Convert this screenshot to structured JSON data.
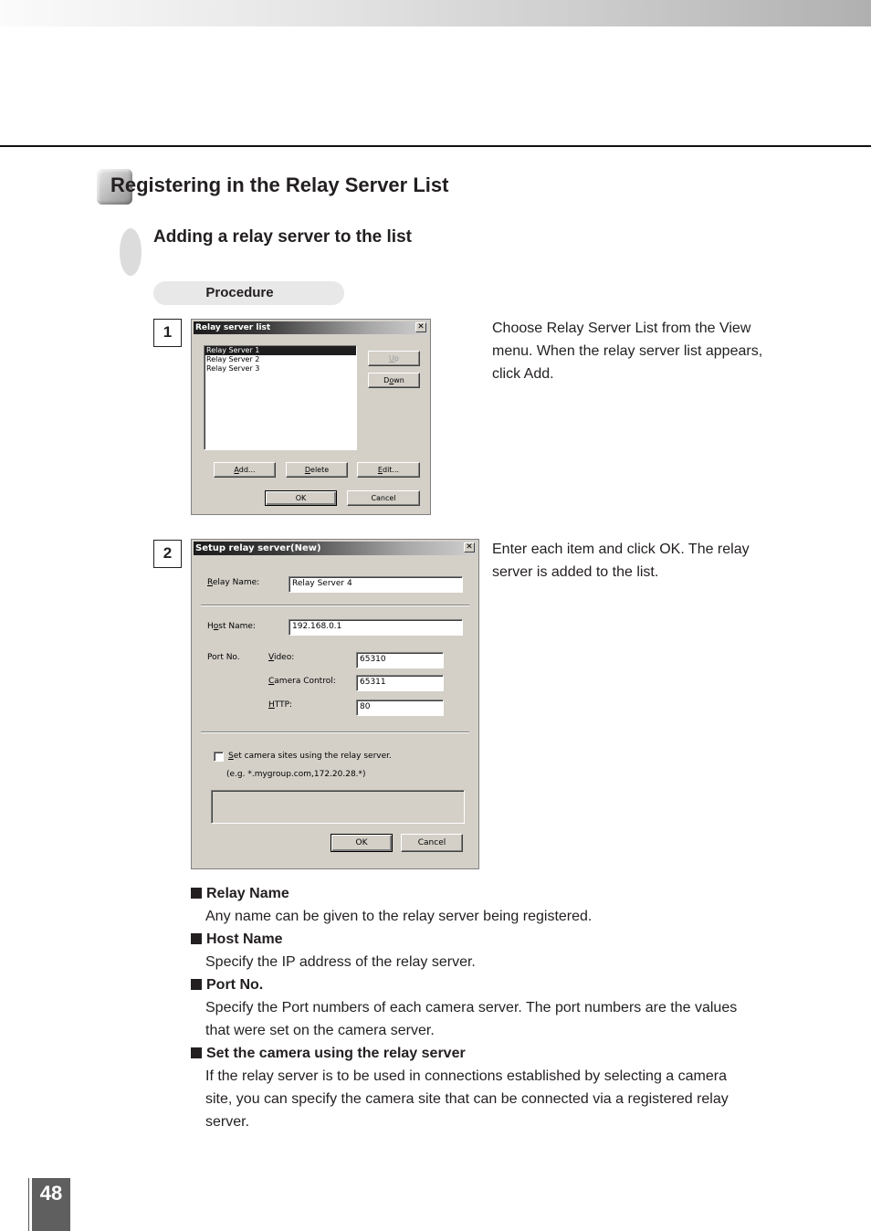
{
  "section_title": "Registering in the Relay Server List",
  "subsection_title": "Adding a relay server to the list",
  "procedure_label": "Procedure",
  "steps": [
    {
      "number": "1",
      "text": "Choose Relay Server List from the View menu. When the relay server list appears, click Add.",
      "dialog": {
        "title": "Relay server list",
        "close_glyph": "✕",
        "list_items": [
          "Relay Server 1",
          "Relay Server 2",
          "Relay Server 3"
        ],
        "selected_index": 0,
        "buttons": {
          "up": {
            "pre": "",
            "u": "U",
            "post": "p"
          },
          "down": {
            "pre": "D",
            "u": "o",
            "post": "wn"
          },
          "add": {
            "pre": "",
            "u": "A",
            "post": "dd..."
          },
          "delete": {
            "pre": "",
            "u": "D",
            "post": "elete"
          },
          "edit": {
            "pre": "",
            "u": "E",
            "post": "dit..."
          },
          "ok": "OK",
          "cancel": "Cancel"
        }
      }
    },
    {
      "number": "2",
      "text": "Enter each item and click OK. The relay server is added to the list.",
      "dialog": {
        "title": "Setup relay server(New)",
        "close_glyph": "✕",
        "relay_name": {
          "label_u": "R",
          "label_rest": "elay Name:",
          "value": "Relay Server 4"
        },
        "host_name": {
          "label_pre": "H",
          "label_u": "o",
          "label_rest": "st Name:",
          "value": "192.168.0.1"
        },
        "port_label": "Port No.",
        "video": {
          "label_u": "V",
          "label_rest": "ideo:",
          "value": "65310"
        },
        "camera_control": {
          "label_u": "C",
          "label_rest": "amera Control:",
          "value": "65311"
        },
        "http": {
          "label_u": "H",
          "label_rest": "TTP:",
          "value": "80"
        },
        "checkbox": {
          "label_u": "S",
          "label_rest": "et camera sites using the relay server.",
          "checked": false
        },
        "example": "(e.g. *.mygroup.com,172.20.28.*)",
        "sites_value": "",
        "ok": "OK",
        "cancel": "Cancel"
      }
    }
  ],
  "descriptions": [
    {
      "heading": "Relay Name",
      "body": "Any name can be given to the relay server being registered."
    },
    {
      "heading": "Host Name",
      "body": "Specify the IP address of the relay server."
    },
    {
      "heading": "Port No.",
      "body": "Specify the Port numbers of each camera server. The port numbers are the values that were set on the camera server."
    },
    {
      "heading": "Set the camera using the relay server",
      "body": "If the relay server is to be used in connections established by selecting a camera site, you can specify the camera site that can be connected via a registered relay server."
    }
  ],
  "page_number": "48"
}
